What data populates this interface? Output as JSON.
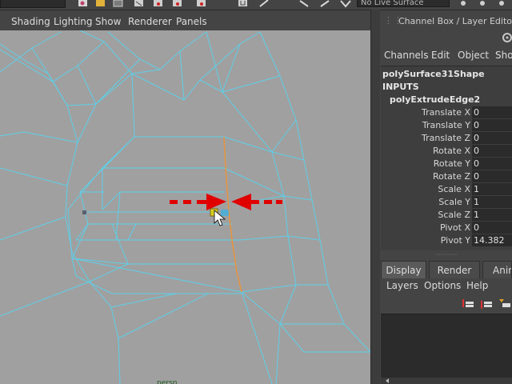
{
  "toolbar": {
    "live_surface_label": "No Live Surface",
    "icons": [
      "render-icon",
      "render-settings-icon",
      "ipr-icon",
      "snap-grid-icon",
      "snap-curve-icon",
      "snap-point-icon",
      "snap-plane-icon",
      "magnet-icon",
      "construction-history-icon",
      "input-icon",
      "output-icon"
    ]
  },
  "viewport": {
    "menus": [
      "Shading",
      "Lighting",
      "Show",
      "Renderer",
      "Panels"
    ],
    "bottom_label": "persp",
    "colors": {
      "background": "#a0a0a0",
      "wireframe": "#5ecfe8",
      "selected_edge": "#e8953f",
      "arrow": "#e00000"
    }
  },
  "channel_box": {
    "title": "Channel Box / Layer Editor",
    "menus": [
      "Channels",
      "Edit",
      "Object",
      "Show"
    ],
    "object_name": "polySurface31Shape",
    "inputs_label": "INPUTS",
    "node_name": "polyExtrudeEdge2",
    "attributes": [
      {
        "label": "Translate X",
        "value": "0"
      },
      {
        "label": "Translate Y",
        "value": "0"
      },
      {
        "label": "Translate Z",
        "value": "0"
      },
      {
        "label": "Rotate X",
        "value": "0"
      },
      {
        "label": "Rotate Y",
        "value": "0"
      },
      {
        "label": "Rotate Z",
        "value": "0"
      },
      {
        "label": "Scale X",
        "value": "1"
      },
      {
        "label": "Scale Y",
        "value": "1"
      },
      {
        "label": "Scale Z",
        "value": "1"
      },
      {
        "label": "Pivot X",
        "value": "0"
      },
      {
        "label": "Pivot Y",
        "value": "14.382"
      }
    ]
  },
  "layer_editor": {
    "tabs": [
      "Display",
      "Render",
      "Anim"
    ],
    "active_tab": "Display",
    "menus": [
      "Layers",
      "Options",
      "Help"
    ]
  }
}
